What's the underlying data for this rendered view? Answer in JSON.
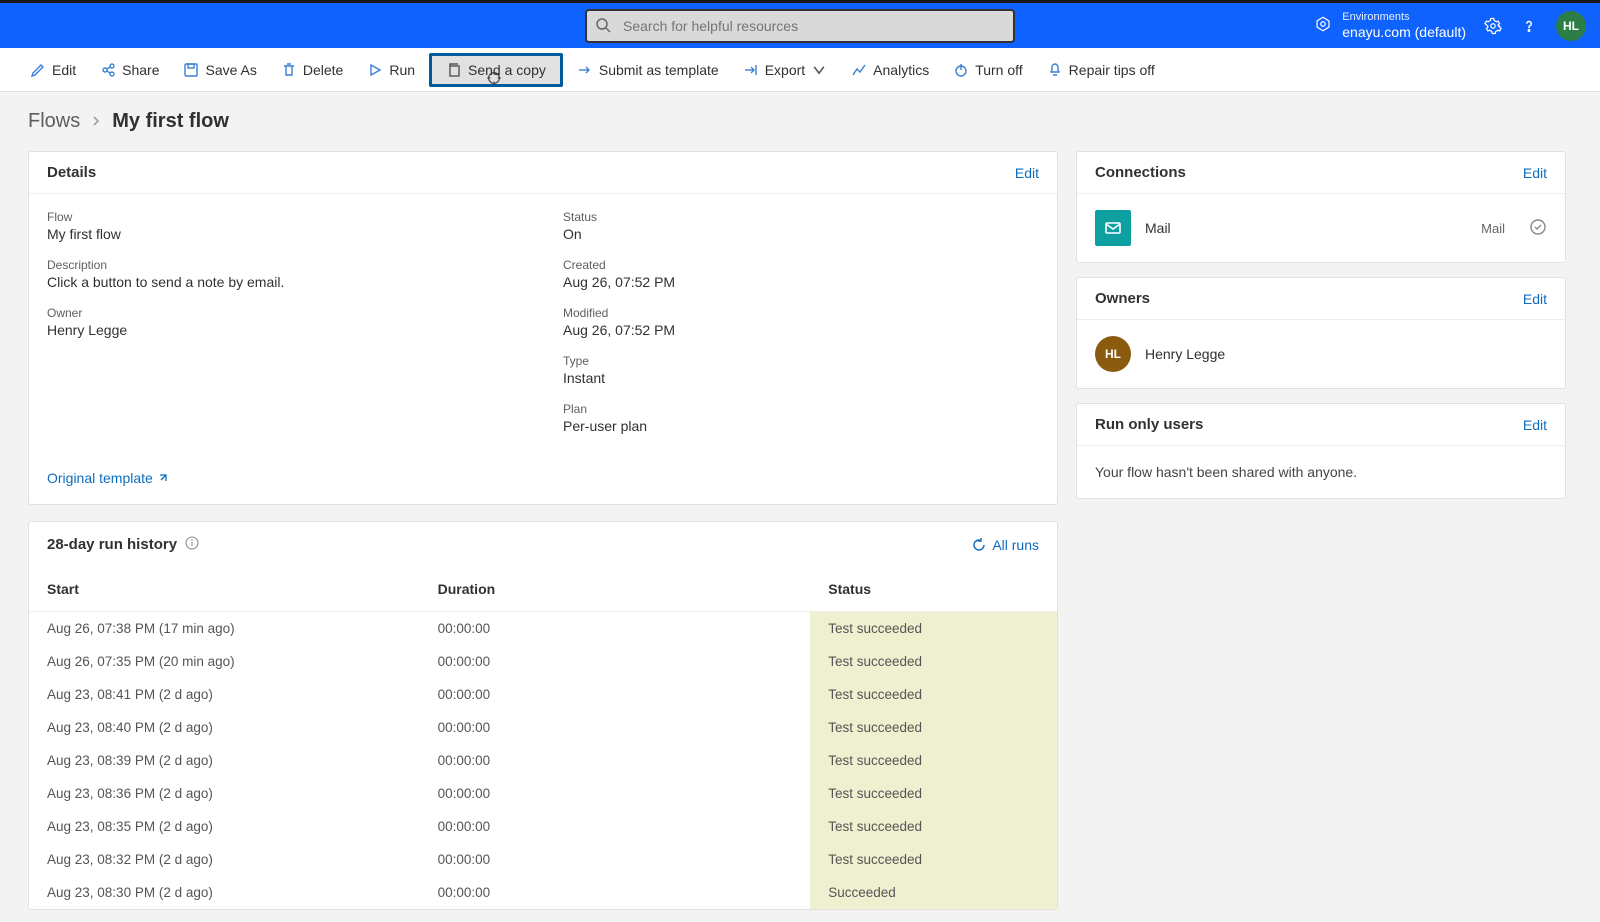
{
  "search": {
    "placeholder": "Search for helpful resources"
  },
  "env": {
    "label": "Environments",
    "name": "enayu.com (default)"
  },
  "user": {
    "initials": "HL"
  },
  "commands": {
    "edit": "Edit",
    "share": "Share",
    "save_as": "Save As",
    "delete": "Delete",
    "run": "Run",
    "send_copy": "Send a copy",
    "submit_template": "Submit as template",
    "export": "Export",
    "analytics": "Analytics",
    "turn_off": "Turn off",
    "repair_tips": "Repair tips off"
  },
  "breadcrumb": {
    "root": "Flows",
    "current": "My first flow"
  },
  "details": {
    "title": "Details",
    "edit": "Edit",
    "flow_label": "Flow",
    "flow_value": "My first flow",
    "desc_label": "Description",
    "desc_value": "Click a button to send a note by email.",
    "owner_label": "Owner",
    "owner_value": "Henry Legge",
    "status_label": "Status",
    "status_value": "On",
    "created_label": "Created",
    "created_value": "Aug 26, 07:52 PM",
    "modified_label": "Modified",
    "modified_value": "Aug 26, 07:52 PM",
    "type_label": "Type",
    "type_value": "Instant",
    "plan_label": "Plan",
    "plan_value": "Per-user plan",
    "original_template": "Original template"
  },
  "history": {
    "title": "28-day run history",
    "all_runs": "All runs",
    "col_start": "Start",
    "col_duration": "Duration",
    "col_status": "Status",
    "rows": [
      {
        "start": "Aug 26, 07:38 PM (17 min ago)",
        "duration": "00:00:00",
        "status": "Test succeeded"
      },
      {
        "start": "Aug 26, 07:35 PM (20 min ago)",
        "duration": "00:00:00",
        "status": "Test succeeded"
      },
      {
        "start": "Aug 23, 08:41 PM (2 d ago)",
        "duration": "00:00:00",
        "status": "Test succeeded"
      },
      {
        "start": "Aug 23, 08:40 PM (2 d ago)",
        "duration": "00:00:00",
        "status": "Test succeeded"
      },
      {
        "start": "Aug 23, 08:39 PM (2 d ago)",
        "duration": "00:00:00",
        "status": "Test succeeded"
      },
      {
        "start": "Aug 23, 08:36 PM (2 d ago)",
        "duration": "00:00:00",
        "status": "Test succeeded"
      },
      {
        "start": "Aug 23, 08:35 PM (2 d ago)",
        "duration": "00:00:00",
        "status": "Test succeeded"
      },
      {
        "start": "Aug 23, 08:32 PM (2 d ago)",
        "duration": "00:00:00",
        "status": "Test succeeded"
      },
      {
        "start": "Aug 23, 08:30 PM (2 d ago)",
        "duration": "00:00:00",
        "status": "Succeeded"
      }
    ]
  },
  "connections": {
    "title": "Connections",
    "edit": "Edit",
    "item_name": "Mail",
    "item_type": "Mail"
  },
  "owners": {
    "title": "Owners",
    "edit": "Edit",
    "initials": "HL",
    "name": "Henry Legge"
  },
  "run_only": {
    "title": "Run only users",
    "edit": "Edit",
    "empty": "Your flow hasn't been shared with anyone."
  }
}
